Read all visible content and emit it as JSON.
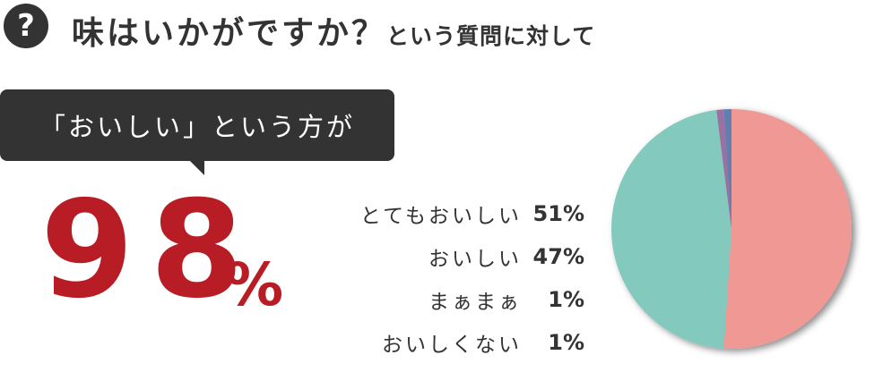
{
  "header": {
    "icon": "question-icon",
    "icon_text": "?",
    "title": "味はいかがですか？",
    "title_suffix": "という質問に対して"
  },
  "callout": {
    "text": "「おいしい」という方が",
    "value": "98",
    "unit": "%"
  },
  "chart_data": {
    "type": "pie",
    "title": "味はいかがですか？",
    "categories": [
      "とてもおいしい",
      "おいしい",
      "まぁまぁ",
      "おいしくない"
    ],
    "values": [
      51,
      47,
      1,
      1
    ],
    "labels": [
      "51%",
      "47%",
      "1%",
      "1%"
    ],
    "colors": [
      "#f09894",
      "#84c9bd",
      "#9b6fa3",
      "#5f7fb3"
    ],
    "start": "top",
    "direction": "clockwise",
    "legend": "left"
  }
}
